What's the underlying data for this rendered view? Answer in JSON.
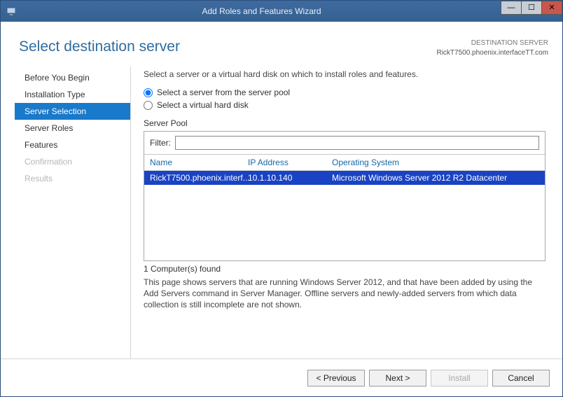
{
  "window": {
    "title": "Add Roles and Features Wizard"
  },
  "meta": {
    "label": "DESTINATION SERVER",
    "server": "RickT7500.phoenix.interfaceTT.com"
  },
  "pageTitle": "Select destination server",
  "nav": {
    "items": [
      {
        "label": "Before You Begin",
        "state": "normal"
      },
      {
        "label": "Installation Type",
        "state": "normal"
      },
      {
        "label": "Server Selection",
        "state": "selected"
      },
      {
        "label": "Server Roles",
        "state": "normal"
      },
      {
        "label": "Features",
        "state": "normal"
      },
      {
        "label": "Confirmation",
        "state": "disabled"
      },
      {
        "label": "Results",
        "state": "disabled"
      }
    ]
  },
  "main": {
    "instruction": "Select a server or a virtual hard disk on which to install roles and features.",
    "radio1": "Select a server from the server pool",
    "radio2": "Select a virtual hard disk",
    "selectedRadio": 0,
    "poolLabel": "Server Pool",
    "filterLabel": "Filter:",
    "filterValue": "",
    "columns": {
      "name": "Name",
      "ip": "IP Address",
      "os": "Operating System"
    },
    "rows": [
      {
        "name": "RickT7500.phoenix.interf...",
        "ip": "10.1.10.140",
        "os": "Microsoft Windows Server 2012 R2 Datacenter",
        "selected": true
      }
    ],
    "count": "1 Computer(s) found",
    "description": "This page shows servers that are running Windows Server 2012, and that have been added by using the Add Servers command in Server Manager. Offline servers and newly-added servers from which data collection is still incomplete are not shown."
  },
  "buttons": {
    "previous": "< Previous",
    "next": "Next >",
    "install": "Install",
    "cancel": "Cancel"
  }
}
